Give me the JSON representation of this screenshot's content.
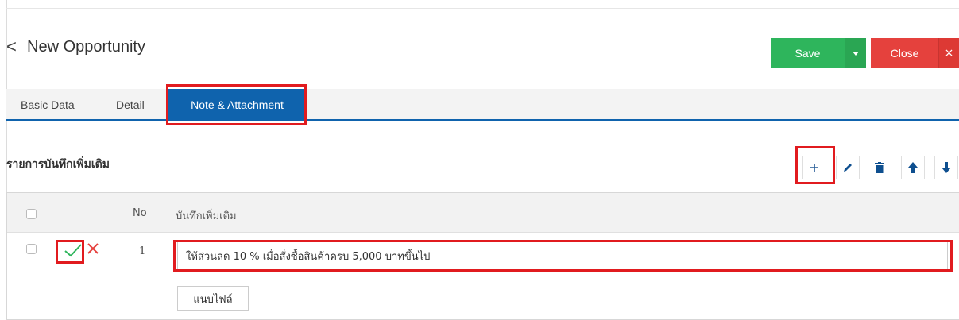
{
  "header": {
    "back_icon": "chevron-left-icon",
    "title": "New Opportunity",
    "save_label": "Save",
    "close_label": "Close",
    "close_x": "×"
  },
  "tabs": [
    {
      "label": "Basic Data",
      "active": false
    },
    {
      "label": "Detail",
      "active": false
    },
    {
      "label": "Note & Attachment",
      "active": true
    }
  ],
  "section": {
    "title": "รายการบันทึกเพิ่มเติม",
    "tools": [
      "plus-icon",
      "pencil-icon",
      "trash-icon",
      "arrow-up-icon",
      "arrow-down-icon"
    ]
  },
  "table": {
    "columns": [
      "No",
      "บันทึกเพิ่มเติม"
    ],
    "rows": [
      {
        "no": "1",
        "note": "ให้ส่วนลด 10 % เมื่อสั่งซื้อสินค้าครบ 5,000 บาทขึ้นไป"
      }
    ],
    "attach_label": "แนบไฟล์"
  },
  "colors": {
    "save": "#2eb55c",
    "close": "#e5413d",
    "tab_active": "#0f63ad",
    "highlight": "#e11b1f",
    "check": "#2eb55c",
    "cancel": "#e5413d"
  }
}
